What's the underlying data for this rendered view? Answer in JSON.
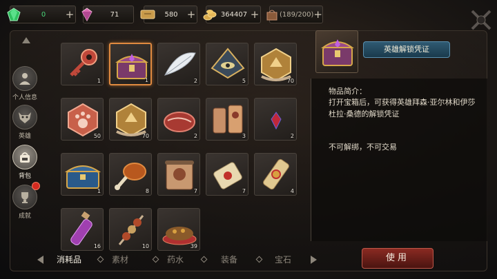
{
  "resources": [
    {
      "name": "emerald-gem",
      "value": "0",
      "color": "#49d67a"
    },
    {
      "name": "pink-diamond",
      "value": "71"
    },
    {
      "name": "gold-ticket",
      "value": "580"
    },
    {
      "name": "gold-coins",
      "value": "364407"
    },
    {
      "name": "backpack-capacity",
      "value": "(189/200)"
    }
  ],
  "plus": "+",
  "nav": [
    {
      "label": "个人信息",
      "icon": "person-icon"
    },
    {
      "label": "英雄",
      "icon": "hero-mask-icon"
    },
    {
      "label": "背包",
      "icon": "backpack-icon"
    },
    {
      "label": "成就",
      "icon": "trophy-icon"
    }
  ],
  "items": [
    {
      "icon": "red-key-icon",
      "count": "1"
    },
    {
      "icon": "treasure-chest-icon",
      "count": "1"
    },
    {
      "icon": "white-feather-icon",
      "count": "2"
    },
    {
      "icon": "eye-emblem-icon",
      "count": "5"
    },
    {
      "icon": "gold-medal-icon",
      "count": "70"
    },
    {
      "icon": "paw-medal-icon",
      "count": "50"
    },
    {
      "icon": "gold-medal-icon",
      "count": "70"
    },
    {
      "icon": "raw-meat-icon",
      "count": "2"
    },
    {
      "icon": "scroll-bundle-icon",
      "count": "3"
    },
    {
      "icon": "red-crystal-icon",
      "count": "2"
    },
    {
      "icon": "blue-chest-icon",
      "count": "1"
    },
    {
      "icon": "roast-drumstick-icon",
      "count": "8"
    },
    {
      "icon": "rune-scroll-icon",
      "count": "7"
    },
    {
      "icon": "sealed-scroll-icon",
      "count": "7"
    },
    {
      "icon": "ornate-scroll-icon",
      "count": "4"
    },
    {
      "icon": "purple-potion-icon",
      "count": "16"
    },
    {
      "icon": "meat-skewer-icon",
      "count": "10"
    },
    {
      "icon": "stew-bowl-icon",
      "count": "39"
    }
  ],
  "detail": {
    "name": "英雄解锁凭证",
    "heading": "物品简介：",
    "desc": "打开宝箱后，可获得英雄拜森·亚尔林和伊莎杜拉·桑德的解锁凭证",
    "note": "不可解绑，不可交易",
    "use_label": "使用"
  },
  "tabs": [
    "消耗品",
    "素材",
    "药水",
    "装备",
    "宝石"
  ],
  "active_tab": 0,
  "active_nav": 2
}
